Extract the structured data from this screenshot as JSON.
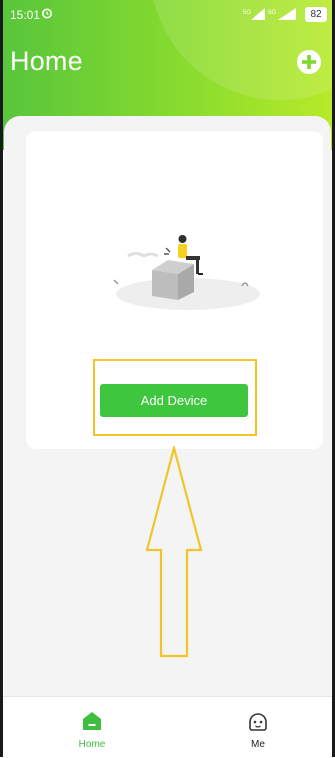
{
  "status_bar": {
    "time": "15:01",
    "signal_a": "5G",
    "signal_b": "5G",
    "battery": "82"
  },
  "header": {
    "title": "Home",
    "add_icon": "plus-circle-icon"
  },
  "empty_state": {
    "illustration": "person-sitting-on-box-illustration",
    "add_device_label": "Add Device"
  },
  "annotation": {
    "highlight_color": "#f2c427",
    "arrow_direction": "up"
  },
  "tabbar": {
    "tabs": [
      {
        "label": "Home",
        "icon": "home-icon",
        "active": true
      },
      {
        "label": "Me",
        "icon": "face-icon",
        "active": false
      }
    ]
  },
  "colors": {
    "accent": "#3fc63f",
    "header_start": "#57c53c",
    "header_end": "#b8ea2a"
  }
}
